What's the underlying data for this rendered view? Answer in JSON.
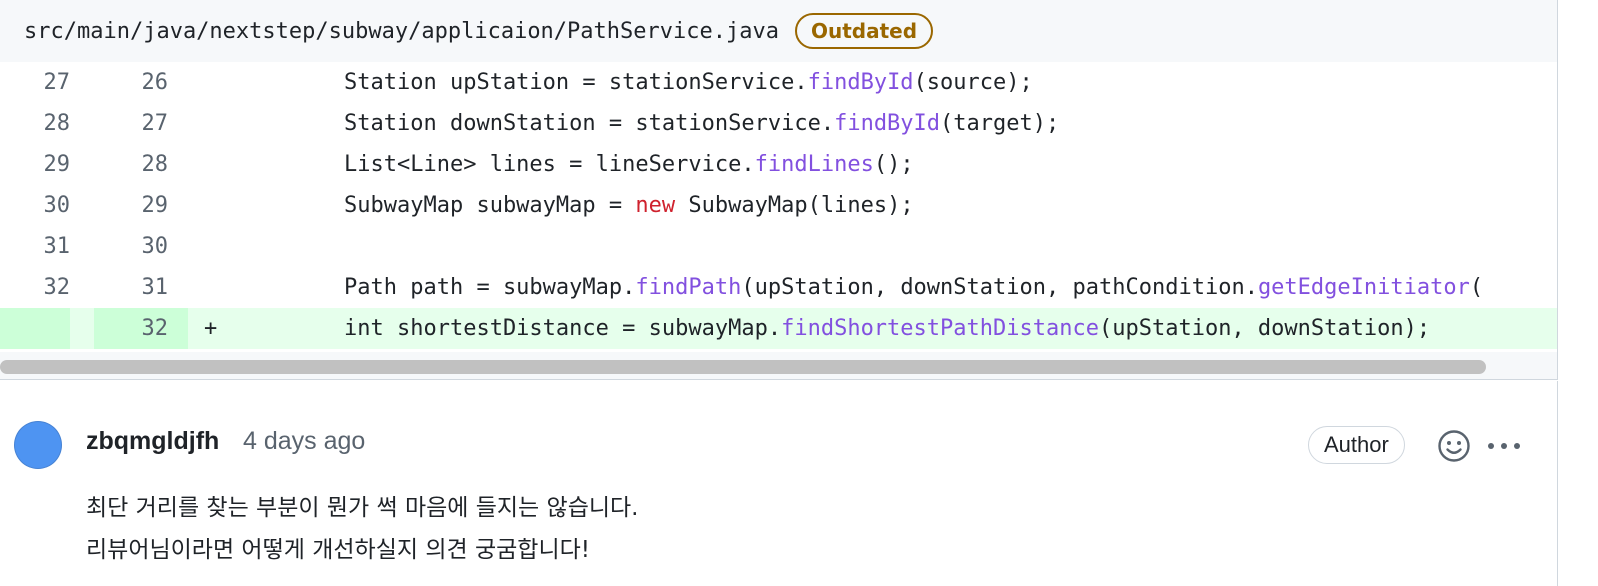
{
  "file_header": {
    "path": "src/main/java/nextstep/subway/applicaion/PathService.java",
    "badge": "Outdated"
  },
  "diff": {
    "rows": [
      {
        "old": "27",
        "new": "26",
        "marker": "",
        "type": "context",
        "tokens": [
          {
            "t": "Station upStation = stationService.",
            "c": "plain"
          },
          {
            "t": "findById",
            "c": "fn"
          },
          {
            "t": "(source);",
            "c": "plain"
          }
        ]
      },
      {
        "old": "28",
        "new": "27",
        "marker": "",
        "type": "context",
        "tokens": [
          {
            "t": "Station downStation = stationService.",
            "c": "plain"
          },
          {
            "t": "findById",
            "c": "fn"
          },
          {
            "t": "(target);",
            "c": "plain"
          }
        ]
      },
      {
        "old": "29",
        "new": "28",
        "marker": "",
        "type": "context",
        "tokens": [
          {
            "t": "List<Line> lines = lineService.",
            "c": "plain"
          },
          {
            "t": "findLines",
            "c": "fn"
          },
          {
            "t": "();",
            "c": "plain"
          }
        ]
      },
      {
        "old": "30",
        "new": "29",
        "marker": "",
        "type": "context",
        "tokens": [
          {
            "t": "SubwayMap subwayMap = ",
            "c": "plain"
          },
          {
            "t": "new",
            "c": "kw"
          },
          {
            "t": " SubwayMap(lines);",
            "c": "plain"
          }
        ]
      },
      {
        "old": "31",
        "new": "30",
        "marker": "",
        "type": "context",
        "tokens": []
      },
      {
        "old": "32",
        "new": "31",
        "marker": "",
        "type": "context",
        "tokens": [
          {
            "t": "Path path = subwayMap.",
            "c": "plain"
          },
          {
            "t": "findPath",
            "c": "fn"
          },
          {
            "t": "(upStation, downStation, pathCondition.",
            "c": "plain"
          },
          {
            "t": "getEdgeInitiator",
            "c": "fn"
          },
          {
            "t": "(",
            "c": "plain"
          }
        ]
      },
      {
        "old": "",
        "new": "32",
        "marker": "+",
        "type": "added",
        "tokens": [
          {
            "t": "int shortestDistance = subwayMap.",
            "c": "plain"
          },
          {
            "t": "findShortestPathDistance",
            "c": "fn"
          },
          {
            "t": "(upStation, downStation);",
            "c": "plain"
          }
        ]
      }
    ]
  },
  "comment": {
    "author": "zbqmgldjfh",
    "time": "4 days ago",
    "badge": "Author",
    "body_lines": [
      "최단 거리를 찾는 부분이 뭔가 썩 마음에 들지는 않습니다.",
      "리뷰어님이라면 어떻게 개선하실지 의견 궁굼합니다!"
    ],
    "avatar_color": "#4e94f2",
    "icons": [
      "smiley-icon",
      "kebab-menu-icon"
    ]
  },
  "colors": {
    "added_bg": "#e6ffec",
    "added_num_bg": "#ccffd8",
    "function": "#8250df",
    "keyword": "#cf222e",
    "outdated": "#9a6700"
  }
}
